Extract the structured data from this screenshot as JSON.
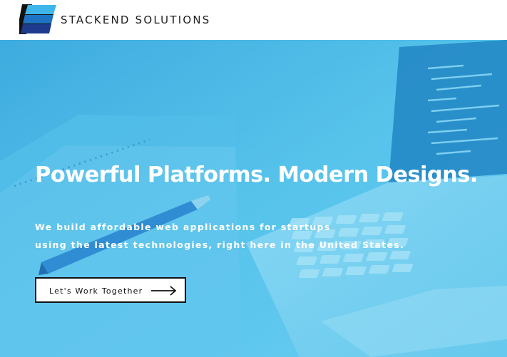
{
  "header": {
    "brand_name": "STACKEND SOLUTIONS",
    "logo_icon": "stacked-stripes-logo-icon"
  },
  "hero": {
    "headline": "Powerful Platforms. Modern Designs.",
    "subtitle_line1": "We build affordable web applications for startups",
    "subtitle_line2": "using the latest technologies, right here in the United States.",
    "cta_label": "Let's Work Together",
    "cta_icon": "arrow-right-icon",
    "background_image": "laptop-notebook-pen-photo"
  },
  "colors": {
    "header_bg": "#ffffff",
    "hero_tint": "#4ebfe6",
    "logo_light_blue": "#3fb6ea",
    "logo_mid_blue": "#1e73c4",
    "logo_dark_blue": "#1e3a8c",
    "logo_black": "#111111",
    "text_light": "#ffffff",
    "button_border": "#111111"
  }
}
